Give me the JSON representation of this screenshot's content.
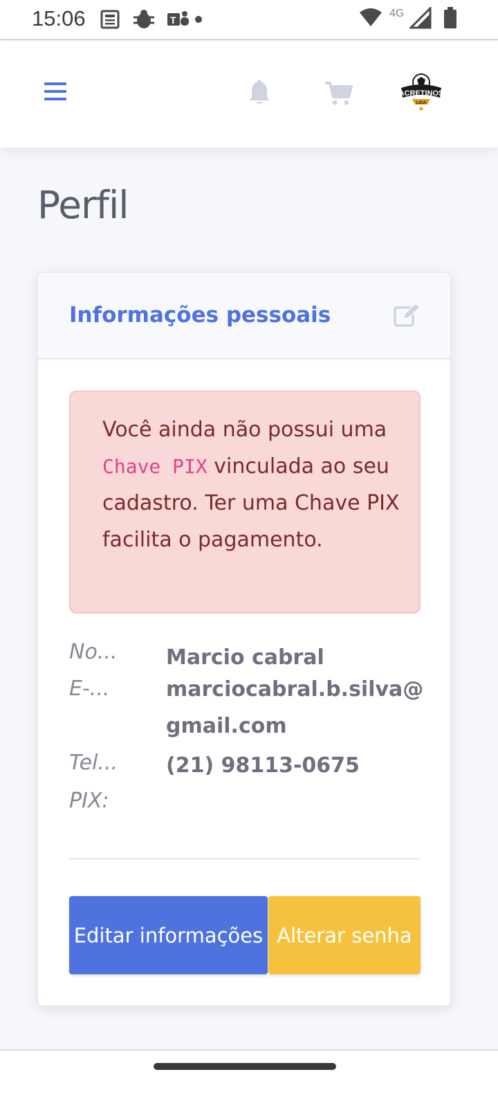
{
  "status_bar": {
    "time": "15:06",
    "network": "4G",
    "notification_icons": [
      "news-icon",
      "bug-icon",
      "teams-icon",
      "dot-icon"
    ],
    "system_icons": [
      "wifi-icon",
      "signal-icon",
      "battery-icon"
    ]
  },
  "header": {
    "menu_icon": "hamburger-icon",
    "bell_icon": "bell-icon",
    "cart_icon": "cart-icon",
    "logo_text": "ACRETINOS",
    "logo_subtext": "LIGA",
    "accent_color": "#4e73df"
  },
  "page": {
    "title": "Perfil"
  },
  "card": {
    "title": "Informações pessoais",
    "edit_icon": "edit-icon",
    "alert": {
      "part1": "Você ainda não possui uma ",
      "code": "Chave PIX",
      "part2": " vinculada ao seu cadastro. Ter uma Chave PIX facilita o pagamento."
    },
    "fields": [
      {
        "label": "No...",
        "value": "Marcio cabral"
      },
      {
        "label": "E-...",
        "value": "marciocabral.b.silva@gmail.com"
      },
      {
        "label": "Tel...",
        "value": "(21) 98113-0675"
      },
      {
        "label": "PIX:",
        "value": ""
      }
    ],
    "buttons": {
      "edit": "Editar informações",
      "change_password": "Alterar senha"
    },
    "colors": {
      "primary": "#4e73df",
      "warning": "#f6c23e",
      "alert_bg": "#f9d8d8",
      "alert_text": "#7a2a2a"
    }
  }
}
